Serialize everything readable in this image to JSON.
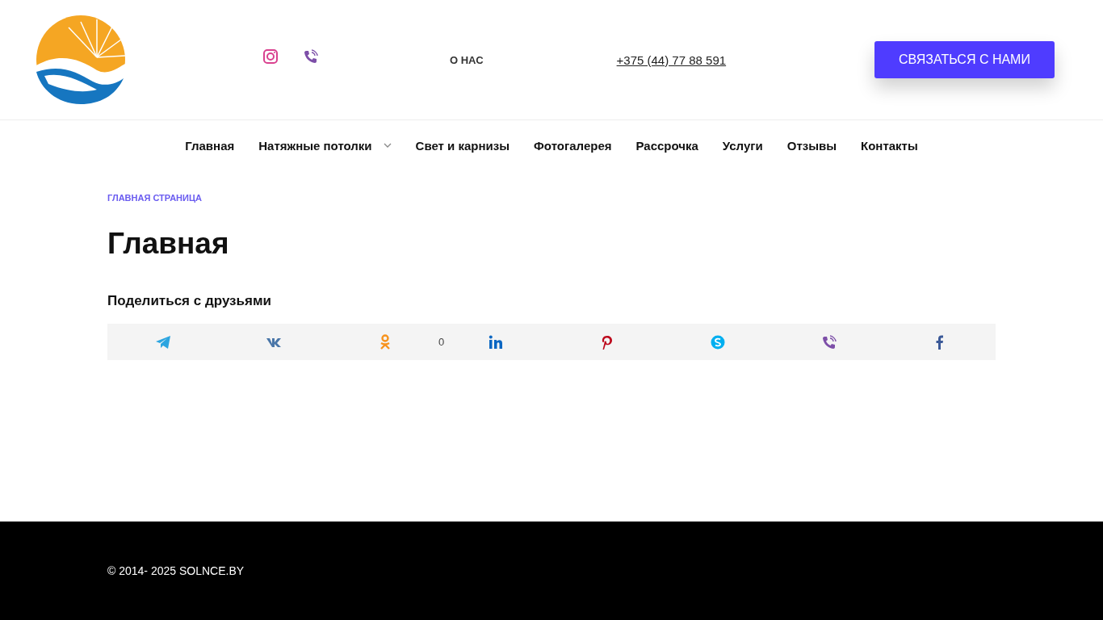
{
  "header": {
    "about_link": "О НАС",
    "phone": "+375 (44) 77 88 591",
    "contact_button": "СВЯЗАТЬСЯ С НАМИ"
  },
  "nav": [
    {
      "label": "Главная",
      "has_dropdown": false
    },
    {
      "label": "Натяжные потолки",
      "has_dropdown": true
    },
    {
      "label": "Свет и карнизы",
      "has_dropdown": false
    },
    {
      "label": "Фотогалерея",
      "has_dropdown": false
    },
    {
      "label": "Рассрочка",
      "has_dropdown": false
    },
    {
      "label": "Услуги",
      "has_dropdown": false
    },
    {
      "label": "Отзывы",
      "has_dropdown": false
    },
    {
      "label": "Контакты",
      "has_dropdown": false
    }
  ],
  "breadcrumb": "ГЛАВНАЯ СТРАНИЦА",
  "page_title": "Главная",
  "share": {
    "title": "Поделиться с друзьями",
    "buttons": [
      {
        "kind": "telegram"
      },
      {
        "kind": "vk"
      },
      {
        "kind": "ok",
        "count": "0"
      },
      {
        "kind": "linkedin"
      },
      {
        "kind": "pinterest"
      },
      {
        "kind": "skype"
      },
      {
        "kind": "viber"
      },
      {
        "kind": "facebook"
      }
    ]
  },
  "footer": {
    "copyright": "© 2014- 2025 SOLNCE.BY"
  }
}
